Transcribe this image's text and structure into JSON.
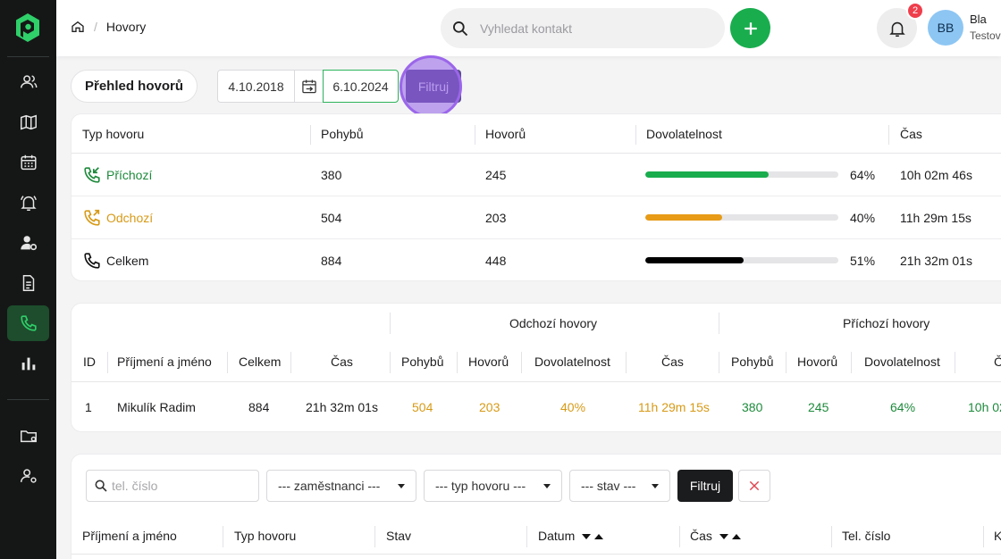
{
  "topbar": {
    "breadcrumb": "Hovory",
    "search_placeholder": "Vyhledat kontakt",
    "notification_count": "2",
    "avatar_initials": "BB",
    "user_name": "Bla",
    "user_subtitle": "Testov"
  },
  "filter": {
    "title": "Přehled hovorů",
    "date_from": "4.10.2018",
    "date_to": "6.10.2024",
    "filter_label": "Filtruj"
  },
  "summary_table": {
    "headers": [
      "Typ hovoru",
      "Pohybů",
      "Hovorů",
      "Dovolatelnost",
      "Čas"
    ],
    "rows": [
      {
        "type": "Příchozí",
        "moves": "380",
        "calls": "245",
        "reach_pct": 64,
        "reach_label": "64%",
        "time": "10h 02m 46s",
        "color": "#19ad4e"
      },
      {
        "type": "Odchozí",
        "moves": "504",
        "calls": "203",
        "reach_pct": 40,
        "reach_label": "40%",
        "time": "11h 29m 15s",
        "color": "#e79b16"
      },
      {
        "type": "Celkem",
        "moves": "884",
        "calls": "448",
        "reach_pct": 51,
        "reach_label": "51%",
        "time": "21h 32m 01s",
        "color": "#000000"
      }
    ]
  },
  "employee_table": {
    "group_outgoing": "Odchozí hovory",
    "group_incoming": "Příchozí hovory",
    "headers": [
      "ID",
      "Příjmení a jméno",
      "Celkem",
      "Čas",
      "Pohybů",
      "Hovorů",
      "Dovolatelnost",
      "Čas",
      "Pohybů",
      "Hovorů",
      "Dovolatelnost",
      "Č"
    ],
    "row": {
      "id": "1",
      "name": "Mikulík Radim",
      "total": "884",
      "time": "21h 32m 01s",
      "out_moves": "504",
      "out_calls": "203",
      "out_reach": "40%",
      "out_time": "11h 29m 15s",
      "in_moves": "380",
      "in_calls": "245",
      "in_reach": "64%",
      "in_time": "10h 02"
    }
  },
  "call_list": {
    "phone_placeholder": "tel. číslo",
    "employee_select": "--- zaměstnanci ---",
    "type_select": "--- typ hovoru ---",
    "status_select": "--- stav ---",
    "filter_label": "Filtruj",
    "headers": [
      "Příjmení a jméno",
      "Typ hovoru",
      "Stav",
      "Datum",
      "Čas",
      "Tel. číslo",
      "K"
    ]
  },
  "colors": {
    "sidebar_bg": "#151716",
    "accent_green": "#19ad4e",
    "accent_orange": "#e79b16",
    "active_nav": "#1d4d2c"
  }
}
